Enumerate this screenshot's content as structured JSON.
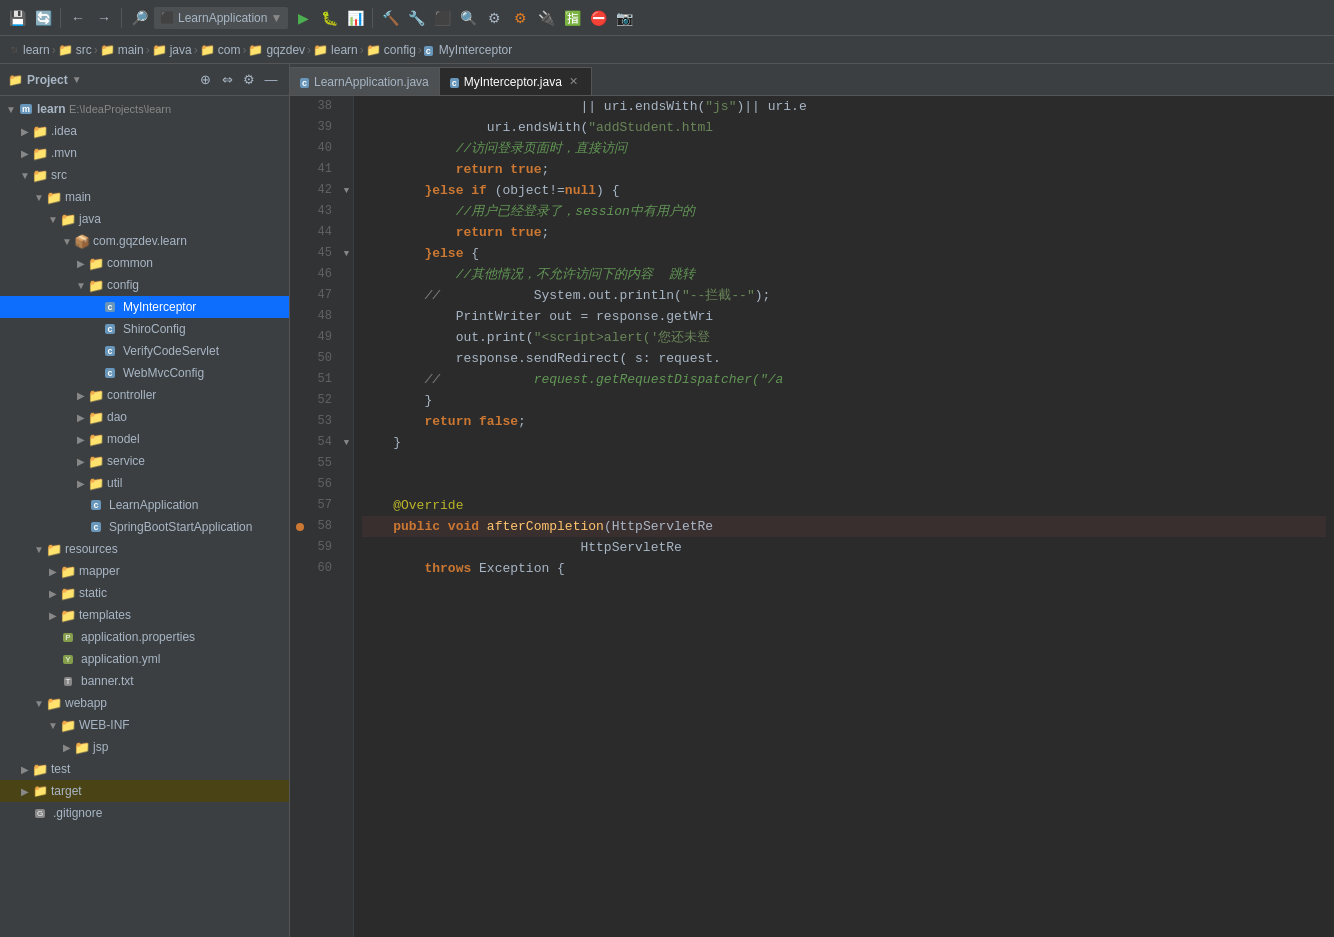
{
  "toolbar": {
    "buttons": [
      {
        "id": "save",
        "icon": "💾",
        "label": "Save All"
      },
      {
        "id": "sync",
        "icon": "🔄",
        "label": "Synchronize"
      },
      {
        "id": "back",
        "icon": "←",
        "label": "Back"
      },
      {
        "id": "forward",
        "icon": "→",
        "label": "Forward"
      },
      {
        "id": "analyze",
        "icon": "🔍",
        "label": "Analyze"
      },
      {
        "id": "run",
        "icon": "▶",
        "label": "Run"
      },
      {
        "id": "debug",
        "icon": "🐛",
        "label": "Debug"
      },
      {
        "id": "profile",
        "icon": "📊",
        "label": "Profile"
      },
      {
        "id": "build",
        "icon": "🔨",
        "label": "Build"
      }
    ],
    "project_selector": {
      "label": "LearnApplication",
      "icon": "▼"
    }
  },
  "breadcrumb": {
    "items": [
      {
        "label": "learn",
        "type": "module"
      },
      {
        "label": "src",
        "type": "folder"
      },
      {
        "label": "main",
        "type": "folder"
      },
      {
        "label": "java",
        "type": "folder"
      },
      {
        "label": "com",
        "type": "folder"
      },
      {
        "label": "gqzdev",
        "type": "folder"
      },
      {
        "label": "learn",
        "type": "folder"
      },
      {
        "label": "config",
        "type": "folder"
      },
      {
        "label": "MyInterceptor",
        "type": "class"
      }
    ]
  },
  "sidebar": {
    "title": "Project",
    "dropdown_icon": "▼",
    "tools": [
      {
        "id": "locate",
        "icon": "⊕"
      },
      {
        "id": "collapse",
        "icon": "⇔"
      },
      {
        "id": "settings",
        "icon": "⚙"
      },
      {
        "id": "hide",
        "icon": "—"
      }
    ],
    "tree": [
      {
        "id": "learn-root",
        "label": "learn",
        "path": "E:\\IdeaProjects\\learn",
        "level": 0,
        "type": "module",
        "expanded": true
      },
      {
        "id": "idea",
        "label": ".idea",
        "level": 1,
        "type": "folder",
        "expanded": false
      },
      {
        "id": "mvn",
        "label": ".mvn",
        "level": 1,
        "type": "folder",
        "expanded": false
      },
      {
        "id": "src",
        "label": "src",
        "level": 1,
        "type": "folder",
        "expanded": true
      },
      {
        "id": "main",
        "label": "main",
        "level": 2,
        "type": "folder",
        "expanded": true
      },
      {
        "id": "java",
        "label": "java",
        "level": 3,
        "type": "folder",
        "expanded": true
      },
      {
        "id": "com-gqzdev-learn",
        "label": "com.gqzdev.learn",
        "level": 4,
        "type": "package",
        "expanded": true
      },
      {
        "id": "common",
        "label": "common",
        "level": 5,
        "type": "folder",
        "expanded": false
      },
      {
        "id": "config",
        "label": "config",
        "level": 5,
        "type": "folder",
        "expanded": true
      },
      {
        "id": "MyInterceptor",
        "label": "MyInterceptor",
        "level": 6,
        "type": "class",
        "selected": true
      },
      {
        "id": "ShiroConfig",
        "label": "ShiroConfig",
        "level": 6,
        "type": "class"
      },
      {
        "id": "VerifyCodeServlet",
        "label": "VerifyCodeServlet",
        "level": 6,
        "type": "class"
      },
      {
        "id": "WebMvcConfig",
        "label": "WebMvcConfig",
        "level": 6,
        "type": "class"
      },
      {
        "id": "controller",
        "label": "controller",
        "level": 5,
        "type": "folder",
        "expanded": false
      },
      {
        "id": "dao",
        "label": "dao",
        "level": 5,
        "type": "folder",
        "expanded": false
      },
      {
        "id": "model",
        "label": "model",
        "level": 5,
        "type": "folder",
        "expanded": false
      },
      {
        "id": "service",
        "label": "service",
        "level": 5,
        "type": "folder",
        "expanded": false
      },
      {
        "id": "util",
        "label": "util",
        "level": 5,
        "type": "folder",
        "expanded": false
      },
      {
        "id": "LearnApplication",
        "label": "LearnApplication",
        "level": 5,
        "type": "class"
      },
      {
        "id": "SpringBootStartApplication",
        "label": "SpringBootStartApplication",
        "level": 5,
        "type": "class"
      },
      {
        "id": "resources",
        "level": 2,
        "label": "resources",
        "type": "folder",
        "expanded": true
      },
      {
        "id": "mapper",
        "label": "mapper",
        "level": 3,
        "type": "folder",
        "expanded": false
      },
      {
        "id": "static",
        "label": "static",
        "level": 3,
        "type": "folder",
        "expanded": false
      },
      {
        "id": "templates",
        "label": "templates",
        "level": 3,
        "type": "folder",
        "expanded": false
      },
      {
        "id": "application-properties",
        "label": "application.properties",
        "level": 3,
        "type": "properties"
      },
      {
        "id": "application-yml",
        "label": "application.yml",
        "level": 3,
        "type": "yaml"
      },
      {
        "id": "banner-txt",
        "label": "banner.txt",
        "level": 3,
        "type": "txt"
      },
      {
        "id": "webapp",
        "label": "webapp",
        "level": 2,
        "type": "folder",
        "expanded": true
      },
      {
        "id": "WEB-INF",
        "label": "WEB-INF",
        "level": 3,
        "type": "folder",
        "expanded": true
      },
      {
        "id": "jsp",
        "label": "jsp",
        "level": 4,
        "type": "folder",
        "expanded": false
      },
      {
        "id": "test",
        "label": "test",
        "level": 1,
        "type": "folder",
        "expanded": false
      },
      {
        "id": "target",
        "label": "target",
        "level": 1,
        "type": "folder-yellow",
        "expanded": false
      },
      {
        "id": "gitignore",
        "label": ".gitignore",
        "level": 1,
        "type": "file"
      }
    ]
  },
  "editor": {
    "tabs": [
      {
        "id": "LearnApplication",
        "label": "LearnApplication.java",
        "type": "java",
        "active": false
      },
      {
        "id": "MyInterceptor",
        "label": "MyInterceptor.java",
        "type": "java",
        "active": true
      }
    ],
    "lines": [
      {
        "num": 38,
        "content": [
          {
            "t": "                            ",
            "c": ""
          },
          {
            "t": "|| uri.endsWith(",
            "c": "var"
          },
          {
            "t": "\"js\"",
            "c": "str"
          },
          {
            "t": ")|| uri.e",
            "c": "var"
          }
        ]
      },
      {
        "num": 39,
        "content": [
          {
            "t": "                uri.endsWith(",
            "c": "var"
          },
          {
            "t": "\"addStudent.html",
            "c": "str"
          }
        ]
      },
      {
        "num": 40,
        "content": [
          {
            "t": "            ",
            "c": ""
          },
          {
            "t": "//访问登录页面时，直接访问",
            "c": "comment-zh"
          }
        ]
      },
      {
        "num": 41,
        "content": [
          {
            "t": "            ",
            "c": ""
          },
          {
            "t": "return",
            "c": "kw"
          },
          {
            "t": " ",
            "c": ""
          },
          {
            "t": "true",
            "c": "kw"
          },
          {
            "t": ";",
            "c": "var"
          }
        ]
      },
      {
        "num": 42,
        "content": [
          {
            "t": "        ",
            "c": ""
          },
          {
            "t": "}else if",
            "c": "kw"
          },
          {
            "t": " (object!=",
            "c": "var"
          },
          {
            "t": "null",
            "c": "kw"
          },
          {
            "t": ") {",
            "c": "var"
          }
        ]
      },
      {
        "num": 43,
        "content": [
          {
            "t": "            ",
            "c": ""
          },
          {
            "t": "//用户已经登录了，",
            "c": "comment-zh"
          },
          {
            "t": "session",
            "c": "italic-comment"
          },
          {
            "t": "中有用户的",
            "c": "comment-zh"
          }
        ]
      },
      {
        "num": 44,
        "content": [
          {
            "t": "            ",
            "c": ""
          },
          {
            "t": "return",
            "c": "kw"
          },
          {
            "t": " ",
            "c": ""
          },
          {
            "t": "true",
            "c": "kw"
          },
          {
            "t": ";",
            "c": "var"
          }
        ]
      },
      {
        "num": 45,
        "content": [
          {
            "t": "        ",
            "c": ""
          },
          {
            "t": "}else",
            "c": "kw"
          },
          {
            "t": " {",
            "c": "var"
          }
        ]
      },
      {
        "num": 46,
        "content": [
          {
            "t": "            ",
            "c": ""
          },
          {
            "t": "//其他情况，不允许访问下的内容  跳转",
            "c": "comment-zh"
          }
        ]
      },
      {
        "num": 47,
        "content": [
          {
            "t": "        ",
            "c": ""
          },
          {
            "t": "//",
            "c": "comment"
          },
          {
            "t": "            ",
            "c": ""
          },
          {
            "t": "System.out.println(",
            "c": "var"
          },
          {
            "t": "\"--拦截--\"",
            "c": "str"
          },
          {
            "t": ");",
            "c": "var"
          }
        ]
      },
      {
        "num": 48,
        "content": [
          {
            "t": "            ",
            "c": ""
          },
          {
            "t": "PrintWriter",
            "c": "type"
          },
          {
            "t": " out = response.getWri",
            "c": "var"
          }
        ]
      },
      {
        "num": 49,
        "content": [
          {
            "t": "            ",
            "c": ""
          },
          {
            "t": "out.print(",
            "c": "var"
          },
          {
            "t": "\"<script>alert('您还未登",
            "c": "str"
          }
        ]
      },
      {
        "num": 50,
        "content": [
          {
            "t": "            ",
            "c": ""
          },
          {
            "t": "response.sendRedirect( s: request.",
            "c": "var"
          }
        ]
      },
      {
        "num": 51,
        "content": [
          {
            "t": "        ",
            "c": ""
          },
          {
            "t": "//",
            "c": "comment"
          },
          {
            "t": "            ",
            "c": ""
          },
          {
            "t": "request.getRequestDispatcher(\"/a",
            "c": "italic-comment"
          }
        ]
      },
      {
        "num": 52,
        "content": [
          {
            "t": "        ",
            "c": ""
          },
          {
            "t": "}",
            "c": "var"
          }
        ]
      },
      {
        "num": 53,
        "content": [
          {
            "t": "        ",
            "c": ""
          },
          {
            "t": "return",
            "c": "kw"
          },
          {
            "t": " ",
            "c": ""
          },
          {
            "t": "false",
            "c": "kw"
          },
          {
            "t": ";",
            "c": "var"
          }
        ]
      },
      {
        "num": 54,
        "content": [
          {
            "t": "    ",
            "c": ""
          },
          {
            "t": "}",
            "c": "var"
          }
        ]
      },
      {
        "num": 55,
        "content": []
      },
      {
        "num": 56,
        "content": []
      },
      {
        "num": 57,
        "content": [
          {
            "t": "    ",
            "c": ""
          },
          {
            "t": "@Override",
            "c": "annotation"
          }
        ]
      },
      {
        "num": 58,
        "content": [
          {
            "t": "    ",
            "c": ""
          },
          {
            "t": "public void ",
            "c": "kw"
          },
          {
            "t": "afterCompletion",
            "c": "fn"
          },
          {
            "t": "(HttpServletRe",
            "c": "type"
          }
        ],
        "has_marker": true
      },
      {
        "num": 59,
        "content": [
          {
            "t": "                            ",
            "c": ""
          },
          {
            "t": "HttpServletRe",
            "c": "type"
          }
        ]
      },
      {
        "num": 60,
        "content": [
          {
            "t": "        ",
            "c": ""
          },
          {
            "t": "throws",
            "c": "kw"
          },
          {
            "t": " ",
            "c": ""
          },
          {
            "t": "Exception",
            "c": "type"
          },
          {
            "t": " {",
            "c": "var"
          }
        ]
      }
    ]
  }
}
